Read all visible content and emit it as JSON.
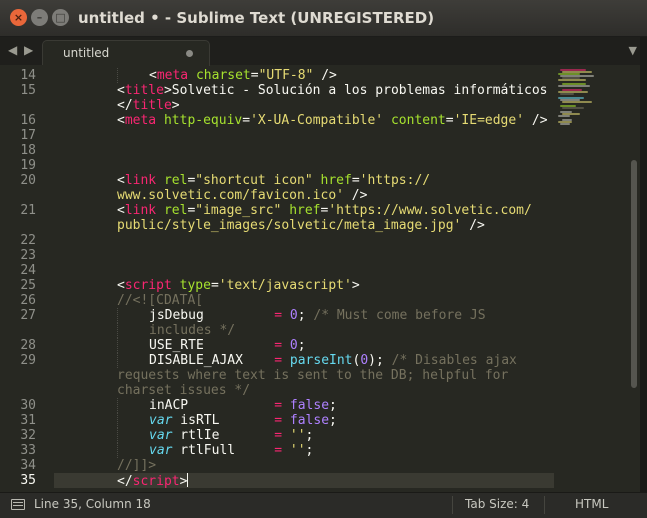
{
  "window": {
    "title": "untitled • - Sublime Text (UNREGISTERED)",
    "buttons": {
      "close": "×",
      "minimize": "–",
      "maximize": "□"
    }
  },
  "tabbar": {
    "nav_left": "◀",
    "nav_right": "▶",
    "tabs": [
      {
        "label": "untitled",
        "modified": true
      }
    ],
    "menu_glyph": "▼"
  },
  "editor": {
    "theme_colors": {
      "background": "#272822",
      "tag": "#f92672",
      "attribute": "#a6e22e",
      "string": "#e6db74",
      "comment": "#75715e",
      "number": "#ae81ff",
      "keyword": "#66d9ef"
    },
    "gutter": [
      "14",
      "15",
      "",
      "16",
      "17",
      "18",
      "19",
      "20",
      "",
      "21",
      "",
      "22",
      "23",
      "24",
      "25",
      "26",
      "27",
      "",
      "28",
      "29",
      "",
      "",
      "30",
      "31",
      "32",
      "33",
      "34",
      "35"
    ],
    "current_line": "35",
    "lines": [
      {
        "indent": 2,
        "tokens": [
          [
            "t",
            "<"
          ],
          [
            "tag",
            "meta"
          ],
          [
            "t",
            " "
          ],
          [
            "attr",
            "charset"
          ],
          [
            "t",
            "="
          ],
          [
            "str",
            "\"UTF-8\""
          ],
          [
            "t",
            " />"
          ]
        ]
      },
      {
        "indent": 1,
        "tokens": [
          [
            "t",
            "<"
          ],
          [
            "tag",
            "title"
          ],
          [
            "t",
            ">Solvetic - Solución a los problemas informáticos"
          ]
        ]
      },
      {
        "indent": 1,
        "tokens": [
          [
            "t",
            "</"
          ],
          [
            "tag",
            "title"
          ],
          [
            "t",
            ">"
          ]
        ]
      },
      {
        "indent": 1,
        "tokens": [
          [
            "t",
            "<"
          ],
          [
            "tag",
            "meta"
          ],
          [
            "t",
            " "
          ],
          [
            "attr",
            "http-equiv"
          ],
          [
            "t",
            "="
          ],
          [
            "str",
            "'X-UA-Compatible'"
          ],
          [
            "t",
            " "
          ],
          [
            "attr",
            "content"
          ],
          [
            "t",
            "="
          ],
          [
            "str",
            "'IE=edge'"
          ],
          [
            "t",
            " />"
          ]
        ]
      },
      {
        "indent": 1,
        "tokens": []
      },
      {
        "indent": 1,
        "tokens": []
      },
      {
        "indent": 1,
        "tokens": []
      },
      {
        "indent": 1,
        "tokens": [
          [
            "t",
            "<"
          ],
          [
            "tag",
            "link"
          ],
          [
            "t",
            " "
          ],
          [
            "attr",
            "rel"
          ],
          [
            "t",
            "="
          ],
          [
            "str",
            "\"shortcut icon\""
          ],
          [
            "t",
            " "
          ],
          [
            "attr",
            "href"
          ],
          [
            "t",
            "="
          ],
          [
            "str",
            "'https://"
          ]
        ]
      },
      {
        "indent": 1,
        "tokens": [
          [
            "str",
            "www.solvetic.com/favicon.ico'"
          ],
          [
            "t",
            " />"
          ]
        ]
      },
      {
        "indent": 1,
        "tokens": [
          [
            "t",
            "<"
          ],
          [
            "tag",
            "link"
          ],
          [
            "t",
            " "
          ],
          [
            "attr",
            "rel"
          ],
          [
            "t",
            "="
          ],
          [
            "str",
            "\"image_src\""
          ],
          [
            "t",
            " "
          ],
          [
            "attr",
            "href"
          ],
          [
            "t",
            "="
          ],
          [
            "str",
            "'https://www.solvetic.com/"
          ]
        ]
      },
      {
        "indent": 1,
        "tokens": [
          [
            "str",
            "public/style_images/solvetic/meta_image.jpg'"
          ],
          [
            "t",
            " />"
          ]
        ]
      },
      {
        "indent": 1,
        "tokens": []
      },
      {
        "indent": 1,
        "tokens": []
      },
      {
        "indent": 1,
        "tokens": []
      },
      {
        "indent": 1,
        "tokens": [
          [
            "t",
            "<"
          ],
          [
            "tag",
            "script"
          ],
          [
            "t",
            " "
          ],
          [
            "attr",
            "type"
          ],
          [
            "t",
            "="
          ],
          [
            "str",
            "'text/javascript'"
          ],
          [
            "t",
            ">"
          ]
        ]
      },
      {
        "indent": 1,
        "tokens": [
          [
            "cmt",
            "//<![CDATA["
          ]
        ]
      },
      {
        "indent": 2,
        "tokens": [
          [
            "t",
            "jsDebug         "
          ],
          [
            "tag",
            "="
          ],
          [
            "t",
            " "
          ],
          [
            "num",
            "0"
          ],
          [
            "t",
            "; "
          ],
          [
            "cmt",
            "/* Must come before JS"
          ]
        ]
      },
      {
        "indent": 2,
        "tokens": [
          [
            "cmt",
            "includes */"
          ]
        ]
      },
      {
        "indent": 2,
        "tokens": [
          [
            "t",
            "USE_RTE         "
          ],
          [
            "tag",
            "="
          ],
          [
            "t",
            " "
          ],
          [
            "num",
            "0"
          ],
          [
            "t",
            ";"
          ]
        ]
      },
      {
        "indent": 2,
        "tokens": [
          [
            "t",
            "DISABLE_AJAX    "
          ],
          [
            "tag",
            "="
          ],
          [
            "t",
            " "
          ],
          [
            "fn",
            "parseInt"
          ],
          [
            "t",
            "("
          ],
          [
            "num",
            "0"
          ],
          [
            "t",
            "); "
          ],
          [
            "cmt",
            "/* Disables ajax"
          ]
        ]
      },
      {
        "indent": 1,
        "tokens": [
          [
            "cmt",
            "requests where text is sent to the DB; helpful for"
          ]
        ]
      },
      {
        "indent": 1,
        "tokens": [
          [
            "cmt",
            "charset issues */"
          ]
        ]
      },
      {
        "indent": 2,
        "tokens": [
          [
            "t",
            "inACP           "
          ],
          [
            "tag",
            "="
          ],
          [
            "t",
            " "
          ],
          [
            "num",
            "false"
          ],
          [
            "t",
            ";"
          ]
        ]
      },
      {
        "indent": 2,
        "tokens": [
          [
            "kw",
            "var"
          ],
          [
            "t",
            " isRTL       "
          ],
          [
            "tag",
            "="
          ],
          [
            "t",
            " "
          ],
          [
            "num",
            "false"
          ],
          [
            "t",
            ";"
          ]
        ]
      },
      {
        "indent": 2,
        "tokens": [
          [
            "kw",
            "var"
          ],
          [
            "t",
            " rtlIe       "
          ],
          [
            "tag",
            "="
          ],
          [
            "t",
            " "
          ],
          [
            "str",
            "''"
          ],
          [
            "t",
            ";"
          ]
        ]
      },
      {
        "indent": 2,
        "tokens": [
          [
            "kw",
            "var"
          ],
          [
            "t",
            " rtlFull     "
          ],
          [
            "tag",
            "="
          ],
          [
            "t",
            " "
          ],
          [
            "str",
            "''"
          ],
          [
            "t",
            ";"
          ]
        ]
      },
      {
        "indent": 1,
        "tokens": [
          [
            "cmt",
            "//]]>"
          ]
        ]
      },
      {
        "indent": 1,
        "tokens": [
          [
            "t",
            "</"
          ],
          [
            "tag",
            "script"
          ],
          [
            "t",
            ">"
          ]
        ],
        "cursor": true
      }
    ]
  },
  "statusbar": {
    "position": "Line 35, Column 18",
    "tab_size": "Tab Size: 4",
    "syntax": "HTML"
  }
}
